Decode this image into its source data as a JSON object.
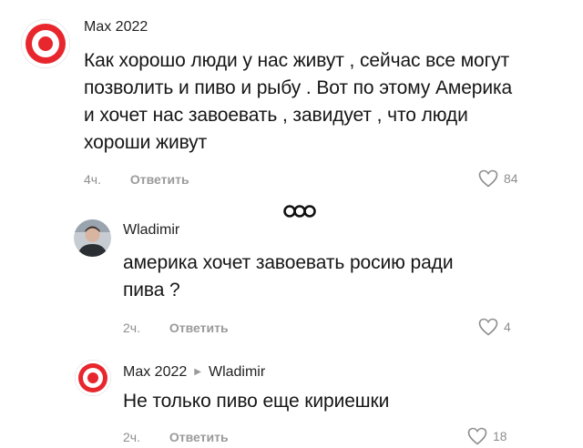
{
  "comments": [
    {
      "author": "Max 2022",
      "text_lines": [
        "Как хорошо люди у нас живут , сейчас все могут",
        "позволить и пиво и рыбу . Вот по этому Америка",
        "и хочет нас завоевать , завидует , что люди",
        "хороши живут"
      ],
      "time": "4ч.",
      "reply_label": "Ответить",
      "likes": "84"
    },
    {
      "author": "Wladimir",
      "text_lines": [
        "америка хочет завоевать росию ради",
        "пива ?"
      ],
      "time": "2ч.",
      "reply_label": "Ответить",
      "likes": "4"
    },
    {
      "author": "Max 2022",
      "reply_to": "Wladimir",
      "text_lines": [
        "Не только пиво еще кириешки"
      ],
      "time": "2ч.",
      "reply_label": "Ответить",
      "likes": "18"
    }
  ],
  "icons": {
    "more": "ellipsis-icon",
    "like": "heart-icon",
    "reply_arrow": "triangle-right-icon"
  },
  "colors": {
    "target_red": "#e8262d",
    "muted": "#8e8e8e"
  }
}
